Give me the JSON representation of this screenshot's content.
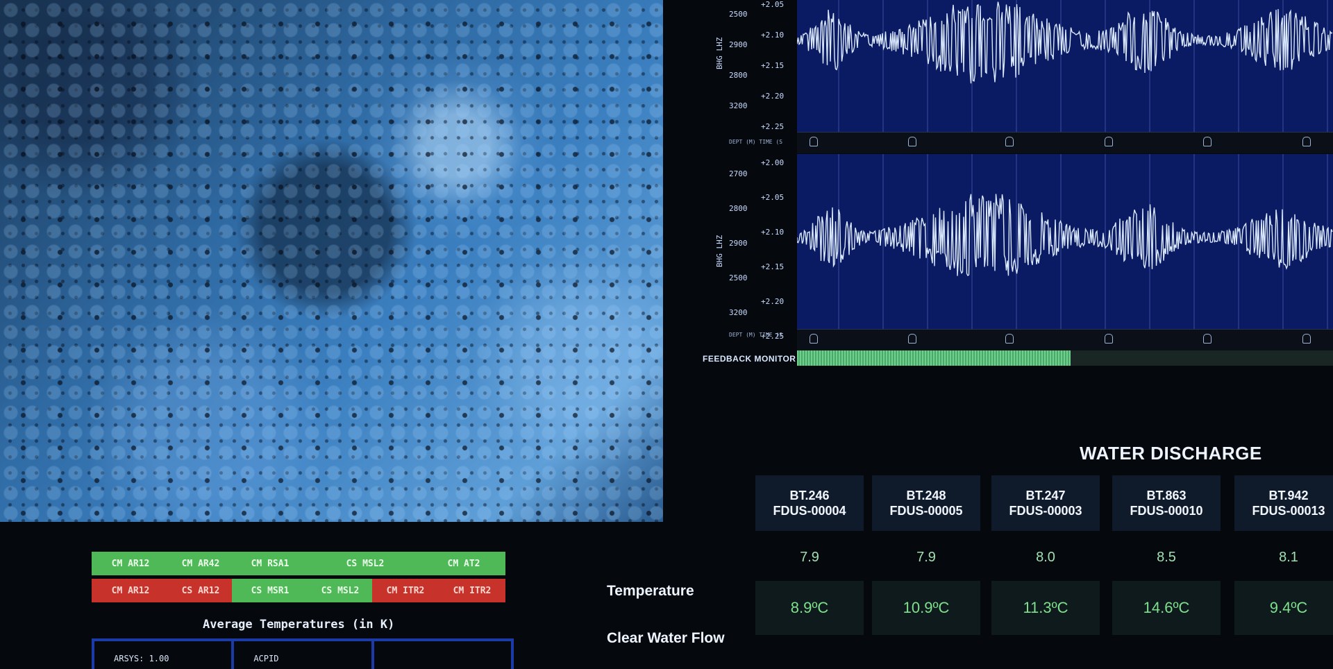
{
  "seismograph": {
    "top": {
      "channel": "BHG LHZ",
      "depth_ticks": [
        "2500",
        "2900",
        "2800",
        "3200"
      ],
      "time_ticks": [
        "+2.05",
        "+2.10",
        "+2.15",
        "+2.20",
        "+2.25"
      ],
      "footer": "DEPT (M)  TIME (S"
    },
    "bottom": {
      "channel": "BHG LHZ",
      "depth_ticks": [
        "2700",
        "2800",
        "2900",
        "2500",
        "3200"
      ],
      "time_ticks": [
        "+2.00",
        "+2.05",
        "+2.10",
        "+2.15",
        "+2.20",
        "+2.25"
      ],
      "footer": "DEPT (M)  TIME (S"
    },
    "feedback": {
      "label": "FEEDBACK MONITOR",
      "level": 0.51
    }
  },
  "status": {
    "row1": [
      {
        "label": "CM AR12",
        "state": "green"
      },
      {
        "label": "CM AR42",
        "state": "green"
      },
      {
        "label": "CM RSA1",
        "state": "green"
      },
      {
        "label": "CS MSL2",
        "state": "green"
      },
      {
        "label": "CM AT2",
        "state": "green"
      }
    ],
    "row2": [
      {
        "label": "CM AR12",
        "state": "red"
      },
      {
        "label": "CS AR12",
        "state": "red"
      },
      {
        "label": "CS MSR1",
        "state": "green"
      },
      {
        "label": "CS MSL2",
        "state": "green"
      },
      {
        "label": "CM ITR2",
        "state": "red"
      },
      {
        "label": "CM ITR2",
        "state": "red"
      }
    ],
    "avg_title": "Average Temperatures (in K)",
    "temp_cells": [
      "ARSYS: 1.00",
      "ACPID",
      ""
    ]
  },
  "water": {
    "title": "WATER DISCHARGE",
    "row_labels": [
      "Temperature",
      "Clear Water Flow"
    ],
    "stations": [
      {
        "id": "BT.246",
        "code": "FDUS-00004",
        "value": "7.9",
        "temp": "8.9ºC"
      },
      {
        "id": "BT.248",
        "code": "FDUS-00005",
        "value": "7.9",
        "temp": "10.9ºC"
      },
      {
        "id": "BT.247",
        "code": "FDUS-00003",
        "value": "8.0",
        "temp": "11.3ºC"
      },
      {
        "id": "BT.863",
        "code": "FDUS-00010",
        "value": "8.5",
        "temp": "14.6ºC"
      },
      {
        "id": "BT.942",
        "code": "FDUS-00013",
        "value": "8.1",
        "temp": "9.4ºC"
      }
    ]
  }
}
